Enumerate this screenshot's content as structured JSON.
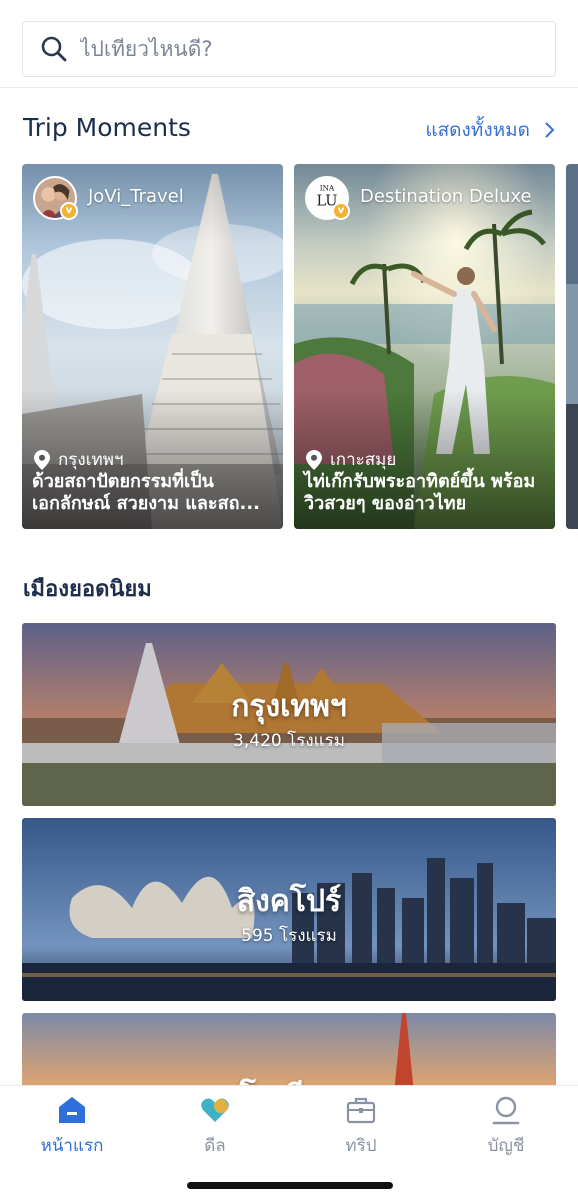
{
  "search": {
    "placeholder": "ไปเที่ยวไหนดี?"
  },
  "trip_moments": {
    "title": "Trip Moments",
    "show_all": "แสดงทั้งหมด",
    "cards": [
      {
        "author": "JoVi_Travel",
        "location": "กรุงเทพฯ",
        "description": "ด้วยสถาปัตยกรรมที่เป็นเอกลักษณ์ สวยงาม และสถ..."
      },
      {
        "author": "Destination Deluxe",
        "location": "เกาะสมุย",
        "description": "ไท่เก๊กรับพระอาทิตย์ขึ้น พร้อมวิวสวยๆ ของอ่าวไทย"
      }
    ]
  },
  "popular_cities": {
    "title": "เมืองยอดนิยม",
    "items": [
      {
        "name": "กรุงเทพฯ",
        "count": "3,420 โรงแรม"
      },
      {
        "name": "สิงคโปร์",
        "count": "595 โรงแรม"
      },
      {
        "name": "โตเกียว",
        "count": ""
      }
    ]
  },
  "nav": {
    "items": [
      {
        "label": "หน้าแรก",
        "icon": "home-icon"
      },
      {
        "label": "ดีล",
        "icon": "deals-heart-icon"
      },
      {
        "label": "ทริป",
        "icon": "suitcase-icon"
      },
      {
        "label": "บัญชี",
        "icon": "account-icon"
      }
    ]
  },
  "colors": {
    "accent": "#2f6fdc",
    "title": "#1f2d4d",
    "badge": "#f3b234"
  }
}
